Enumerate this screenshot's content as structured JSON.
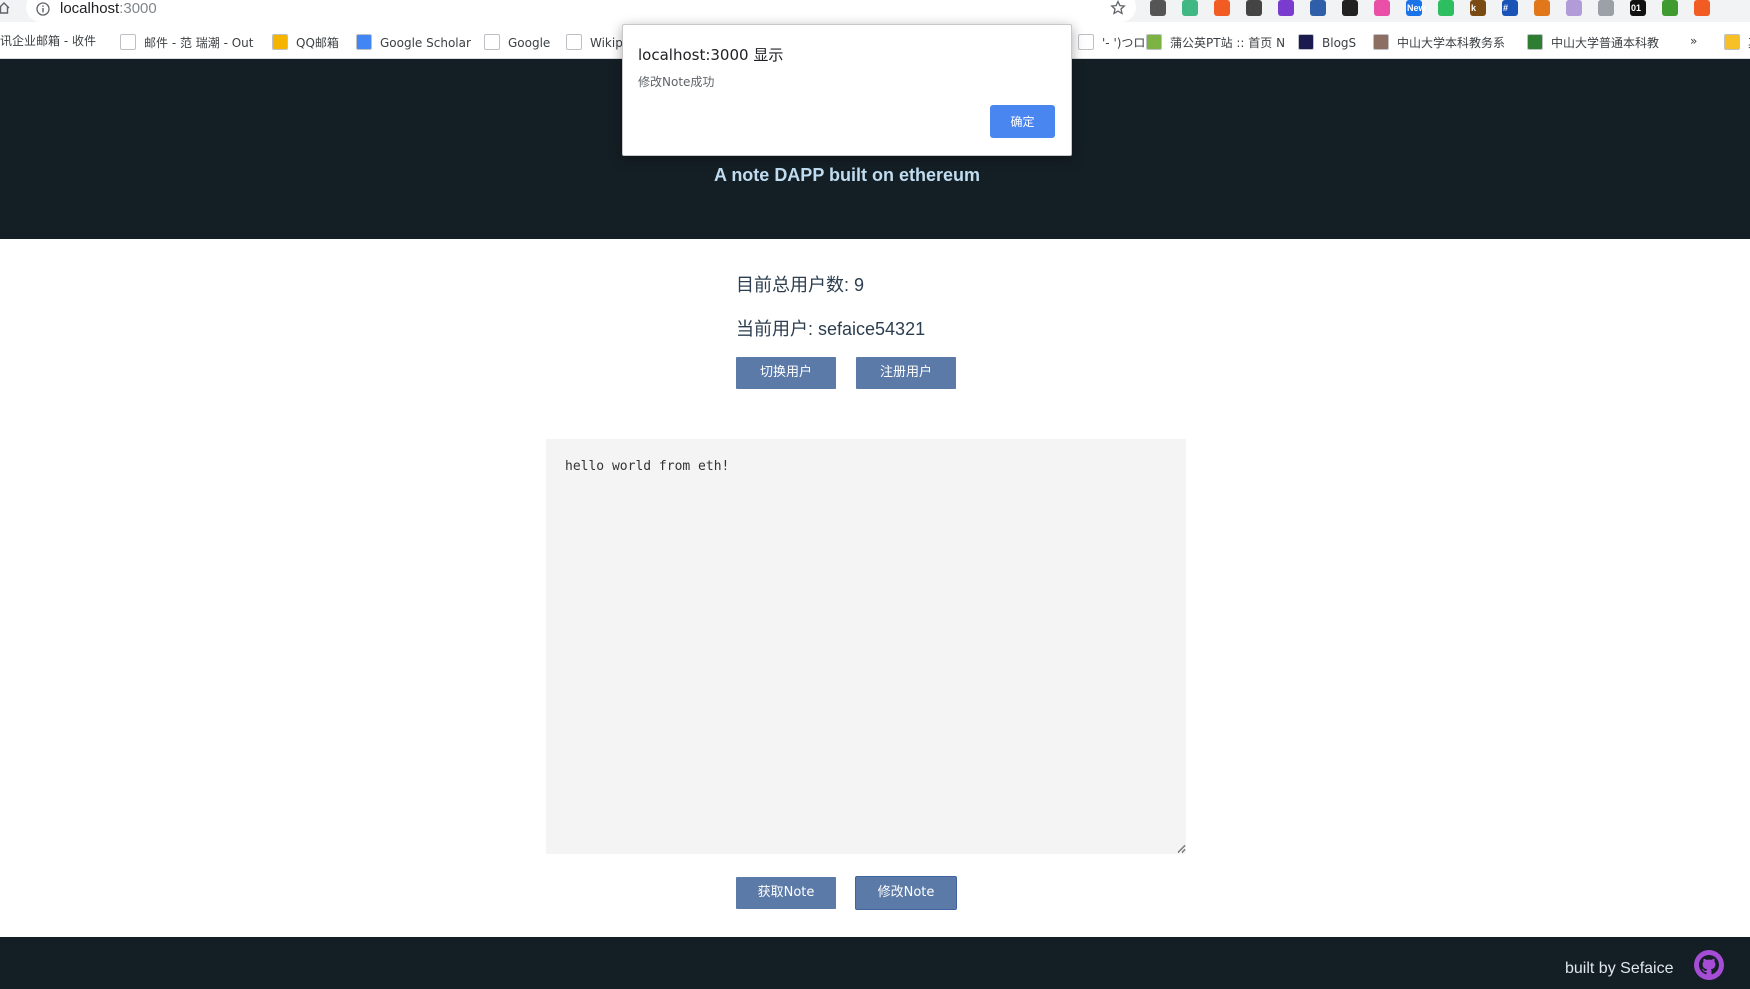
{
  "browser": {
    "url_host": "localhost",
    "url_port": ":3000",
    "extensions": [
      {
        "name": "extension-clock-icon",
        "color": "#555555",
        "label": ""
      },
      {
        "name": "extension-vue-icon",
        "color": "#41b883",
        "label": ""
      },
      {
        "name": "extension-orange-icon",
        "color": "#f25c22",
        "label": ""
      },
      {
        "name": "extension-screenshot-icon",
        "color": "#444444",
        "label": ""
      },
      {
        "name": "extension-pen-icon",
        "color": "#7a3ccf",
        "label": ""
      },
      {
        "name": "extension-monitor-icon",
        "color": "#2f5fa8",
        "label": ""
      },
      {
        "name": "extension-terminal-icon",
        "color": "#222222",
        "label": ""
      },
      {
        "name": "extension-gradient-icon",
        "color": "#e94fa6",
        "label": ""
      },
      {
        "name": "extension-new-icon",
        "color": "#1a73e8",
        "label": "New"
      },
      {
        "name": "extension-evernote-icon",
        "color": "#2dbe60",
        "label": ""
      },
      {
        "name": "extension-k-icon",
        "color": "#7a4a12",
        "label": "k"
      },
      {
        "name": "extension-grid-icon",
        "color": "#1a53b8",
        "label": "#"
      },
      {
        "name": "extension-fox-icon",
        "color": "#e2761b",
        "label": ""
      },
      {
        "name": "extension-pdf-icon",
        "color": "#b19cd9",
        "label": ""
      },
      {
        "name": "extension-zip-icon",
        "color": "#9aa0a6",
        "label": ""
      },
      {
        "name": "extension-01-icon",
        "color": "#111111",
        "label": "01"
      },
      {
        "name": "extension-cors-icon",
        "color": "#3f9a2f",
        "label": ""
      },
      {
        "name": "extension-close-icon",
        "color": "#f25c22",
        "label": ""
      }
    ],
    "bookmarks": [
      {
        "label": "讯企业邮箱 - 收件",
        "icon_color": "#ffffff"
      },
      {
        "label": "邮件 - 范 瑞潮 - Out",
        "icon_color": "#ffffff"
      },
      {
        "label": "QQ邮箱",
        "icon_color": "#f4b400"
      },
      {
        "label": "Google Scholar",
        "icon_color": "#4285f4"
      },
      {
        "label": "Google",
        "icon_color": "#ffffff"
      },
      {
        "label": "Wikip",
        "icon_color": "#ffffff"
      },
      {
        "label": "'- ')つロ",
        "icon_color": "#ffffff"
      },
      {
        "label": "蒲公英PT站 :: 首页 N",
        "icon_color": "#7cb342"
      },
      {
        "label": "BlogS",
        "icon_color": "#1a1a4e"
      },
      {
        "label": "中山大学本科教务系",
        "icon_color": "#8d6e63"
      },
      {
        "label": "中山大学普通本科教",
        "icon_color": "#2e7d32"
      },
      {
        "label": "»",
        "icon_color": "#ffffff"
      },
      {
        "label": "其",
        "icon_color": "#f6c026"
      }
    ]
  },
  "dialog": {
    "title": "localhost:3000 显示",
    "message": "修改Note成功",
    "ok_label": "确定"
  },
  "header": {
    "subtitle": "A note DAPP built on ethereum"
  },
  "main": {
    "total_users_text": "目前总用户数: 9",
    "current_user_text": "当前用户: sefaice54321",
    "switch_user_label": "切换用户",
    "register_user_label": "注册用户",
    "note_content": "hello world from eth!",
    "get_note_label": "获取Note",
    "modify_note_label": "修改Note"
  },
  "footer": {
    "credit": "built by Sefaice"
  }
}
